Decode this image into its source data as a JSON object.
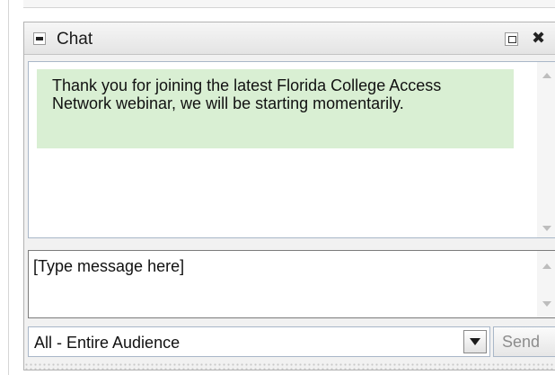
{
  "panel": {
    "title": "Chat",
    "icons": {
      "collapse": "minus-icon",
      "popout": "popout-icon",
      "close": "close-icon",
      "close_glyph": "✖"
    }
  },
  "messages": [
    {
      "text": "Thank you for joining the latest Florida College Access Network webinar, we will be starting momentarily."
    }
  ],
  "input": {
    "value": "[Type message here]"
  },
  "audience_select": {
    "selected": "All - Entire Audience"
  },
  "send_button": {
    "label": "Send"
  },
  "colors": {
    "message_bg": "#d9efd3",
    "border_accent": "#a9b7c8",
    "send_text": "#8c8c8c"
  }
}
